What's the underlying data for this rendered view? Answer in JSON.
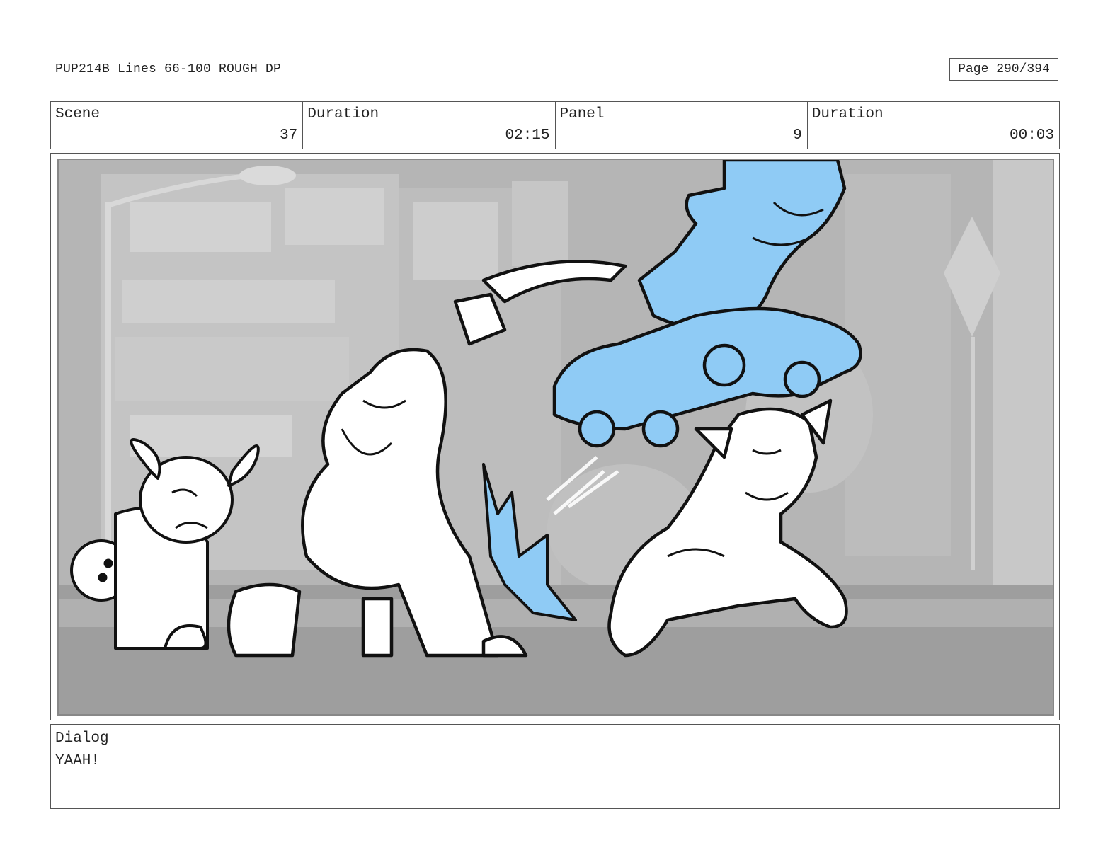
{
  "header": {
    "title": "PUP214B Lines 66-100 ROUGH DP",
    "page": "Page 290/394"
  },
  "info": {
    "scene_label": "Scene",
    "scene_value": "37",
    "scene_duration_label": "Duration",
    "scene_duration_value": "02:15",
    "panel_label": "Panel",
    "panel_value": "9",
    "panel_duration_label": "Duration",
    "panel_duration_value": "00:03"
  },
  "panel_image": {
    "description_icon": "storyboard-sketch-image",
    "accent_color": "#8fcbf5"
  },
  "dialog": {
    "label": "Dialog",
    "text": "YAAH!"
  }
}
